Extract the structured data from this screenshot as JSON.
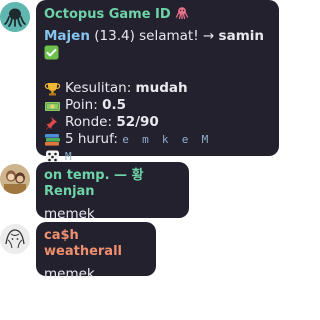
{
  "messages": [
    {
      "author": "Octopus Game ID",
      "author_emoji": "octopus",
      "author_color": "#6ed3a7",
      "headline": {
        "player": "Majen",
        "score": "(13.4)",
        "text": "selamat!",
        "arrow": "→",
        "winner": "samin",
        "check_icon": "check-mark-button"
      },
      "stats": [
        {
          "icon": "trophy-icon",
          "label": "Kesulitan:",
          "value": "mudah"
        },
        {
          "icon": "money-icon",
          "label": "Poin:",
          "value": "0.5"
        },
        {
          "icon": "pushpin-icon",
          "label": "Ronde:",
          "value": "52/90"
        },
        {
          "icon": "books-icon",
          "label": "5 huruf:",
          "value": "e m k e M",
          "mono": true
        },
        {
          "icon": "dice-icon",
          "label": "",
          "value": "M _ _ _ _",
          "mono": true
        }
      ]
    },
    {
      "author": "on temp. — 황 Renjan",
      "author_color": "#6ed3a7",
      "text": "memek"
    },
    {
      "author": "ca$h weatherall",
      "author_color": "#ef8f70",
      "text": "memek"
    }
  ],
  "colors": {
    "bubble_bg": "#23212e",
    "text": "#e8e8ee",
    "link_blue": "#86c4f0",
    "mono_blue": "#8fb0cc"
  }
}
